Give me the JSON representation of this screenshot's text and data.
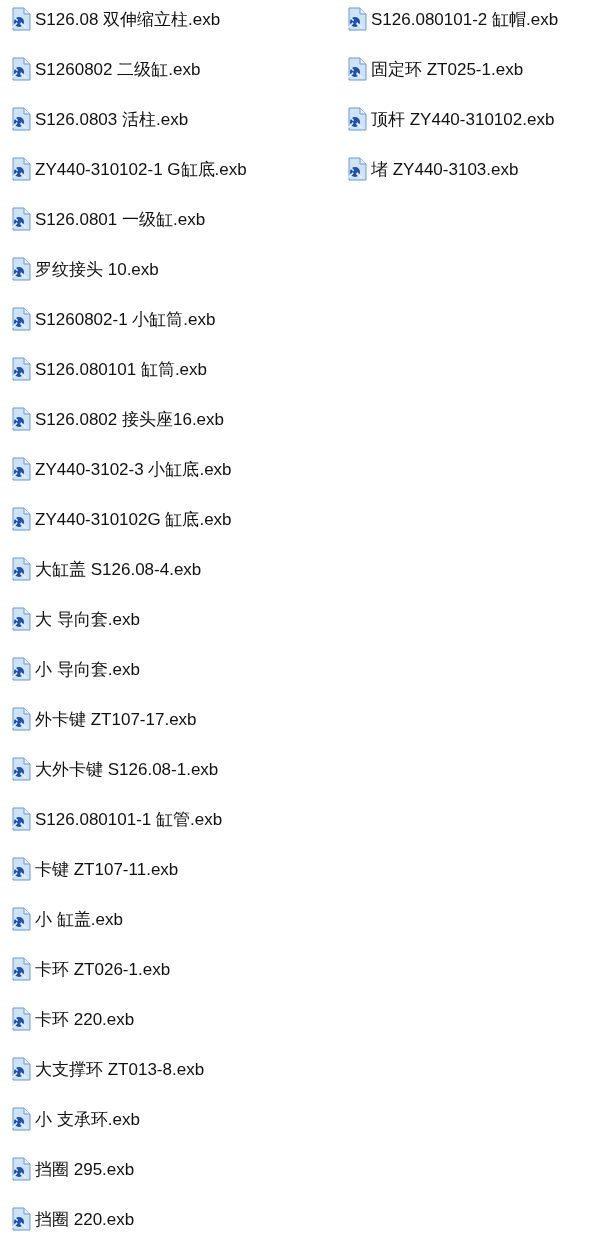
{
  "files": [
    {
      "name": "S126.08 双伸缩立柱.exb"
    },
    {
      "name": "S1260802 二级缸.exb"
    },
    {
      "name": "S126.0803 活柱.exb"
    },
    {
      "name": "ZY440-310102-1 G缸底.exb"
    },
    {
      "name": "S126.0801 一级缸.exb"
    },
    {
      "name": "罗纹接头 10.exb"
    },
    {
      "name": "S1260802-1 小缸筒.exb"
    },
    {
      "name": "S126.080101 缸筒.exb"
    },
    {
      "name": "S126.0802 接头座16.exb"
    },
    {
      "name": "ZY440-3102-3 小缸底.exb"
    },
    {
      "name": "ZY440-310102G 缸底.exb"
    },
    {
      "name": "大缸盖 S126.08-4.exb"
    },
    {
      "name": "大 导向套.exb"
    },
    {
      "name": "小 导向套.exb"
    },
    {
      "name": "外卡键 ZT107-17.exb"
    },
    {
      "name": "大外卡键 S126.08-1.exb"
    },
    {
      "name": "S126.080101-1 缸管.exb"
    },
    {
      "name": "卡键 ZT107-11.exb"
    },
    {
      "name": "小 缸盖.exb"
    },
    {
      "name": "卡环 ZT026-1.exb"
    },
    {
      "name": "卡环 220.exb"
    },
    {
      "name": "大支撑环 ZT013-8.exb"
    },
    {
      "name": "小 支承环.exb"
    },
    {
      "name": "挡圈 295.exb"
    },
    {
      "name": "挡圈 220.exb"
    },
    {
      "name": "S126.080101-2 缸帽.exb"
    },
    {
      "name": "固定环 ZT025-1.exb"
    },
    {
      "name": "顶杆 ZY440-310102.exb"
    },
    {
      "name": "堵 ZY440-3103.exb"
    }
  ]
}
